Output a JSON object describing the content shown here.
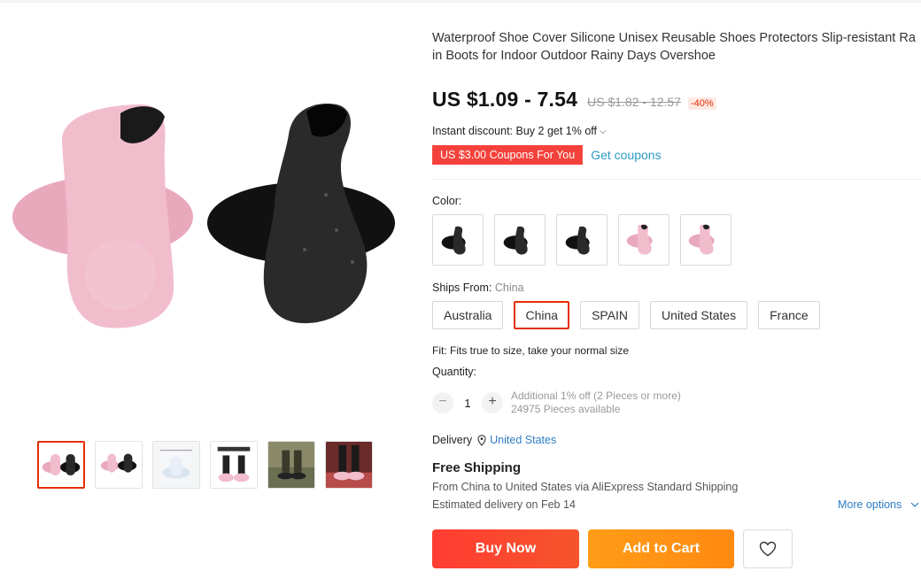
{
  "product": {
    "title": "Waterproof Shoe Cover Silicone Unisex Reusable Shoes Protectors Slip-resistant Rain Boots for Indoor Outdoor Rainy Days Overshoe"
  },
  "price": {
    "current": "US $1.09 - 7.54",
    "original": "US $1.82 - 12.57",
    "discount": "-40%"
  },
  "instant_discount": {
    "text": "Instant discount: Buy 2 get 1% off",
    "chevron": "chevron-down-icon"
  },
  "coupon": {
    "tag": "US $3.00 Coupons For You",
    "action": "Get coupons"
  },
  "color": {
    "label": "Color:",
    "swatches": [
      "black",
      "black",
      "black",
      "pink",
      "pink"
    ]
  },
  "ships_from": {
    "label": "Ships From:",
    "selected": "China",
    "options": [
      "Australia",
      "China",
      "SPAIN",
      "United States",
      "France"
    ]
  },
  "fit": {
    "text": "Fit: Fits true to size, take your normal size"
  },
  "quantity": {
    "label": "Quantity:",
    "value": "1",
    "minus": "−",
    "plus": "+",
    "info_line1": "Additional 1% off (2 Pieces or more)",
    "info_line2": "24975 Pieces available"
  },
  "delivery": {
    "label": "Delivery",
    "destination": "United States",
    "free_shipping": "Free Shipping",
    "via": "From China to United States via AliExpress Standard Shipping",
    "estimate": "Estimated delivery on Feb 14",
    "more_options": "More options"
  },
  "actions": {
    "buy_now": "Buy Now",
    "add_to_cart": "Add to Cart",
    "wishlist_icon": "heart-icon"
  },
  "thumbnails": {
    "count": 6,
    "active": 0
  },
  "colors": {
    "accent": "#e62e04",
    "buy": "#ff3d32",
    "cart": "#ff9c16",
    "link": "#2e7dc3",
    "pink_shoe": "#f0b9cb",
    "black_shoe": "#222222"
  }
}
